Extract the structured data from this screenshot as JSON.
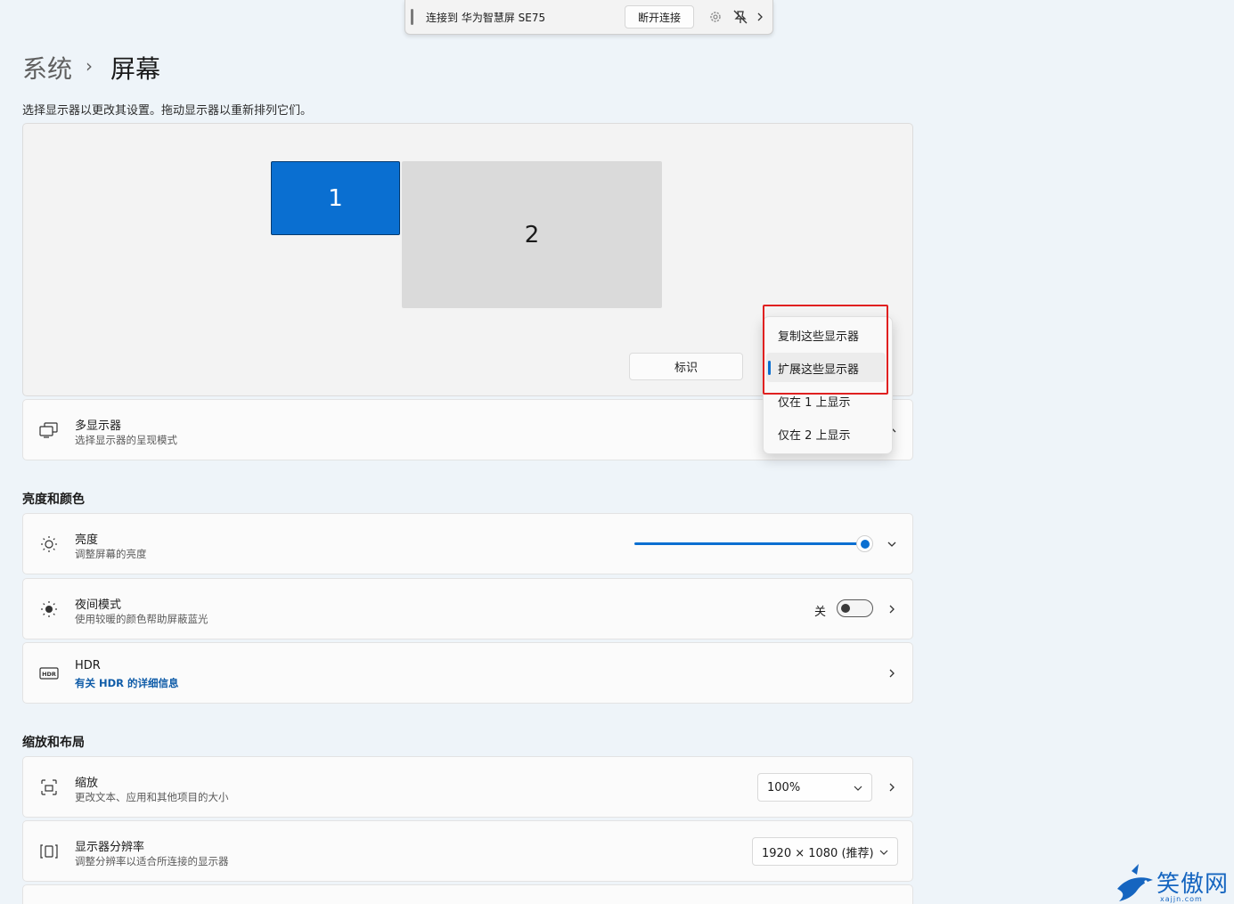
{
  "connection_bar": {
    "text": "连接到 华为智慧屏 SE75",
    "disconnect_label": "断开连接",
    "settings_icon": "gear-icon",
    "pin_icon": "unpin-icon",
    "expand_icon": "chevron-right-icon"
  },
  "breadcrumb": {
    "root": "系统",
    "separator": "›",
    "current": "屏幕"
  },
  "hint": "选择显示器以更改其设置。拖动显示器以重新排列它们。",
  "arrangement": {
    "monitor_1": "1",
    "monitor_2": "2",
    "identify_label": "标识"
  },
  "multi_display": {
    "title": "多显示器",
    "subtitle": "选择显示器的呈现模式",
    "icon": "multi-monitor-icon"
  },
  "dropdown_menu": {
    "items": [
      "复制这些显示器",
      "扩展这些显示器",
      "仅在 1 上显示",
      "仅在 2 上显示"
    ],
    "selected_index": 1
  },
  "brightness_section": {
    "title": "亮度和颜色",
    "brightness": {
      "title": "亮度",
      "subtitle": "调整屏幕的亮度",
      "icon": "sun-icon",
      "value_percent": 100
    },
    "night_mode": {
      "title": "夜间模式",
      "subtitle": "使用较暖的颜色帮助屏蔽蓝光",
      "icon": "night-light-icon",
      "state_label": "关",
      "on": false
    },
    "hdr": {
      "title": "HDR",
      "link": "有关 HDR 的详细信息",
      "icon": "hdr-icon"
    }
  },
  "layout_section": {
    "title": "缩放和布局",
    "scale": {
      "title": "缩放",
      "subtitle": "更改文本、应用和其他项目的大小",
      "icon": "scale-icon",
      "value": "100%"
    },
    "resolution": {
      "title": "显示器分辨率",
      "subtitle": "调整分辨率以适合所连接的显示器",
      "icon": "resolution-icon",
      "value": "1920 × 1080 (推荐)"
    }
  },
  "watermark": {
    "text": "笑傲网",
    "sub": "xajjn.com"
  },
  "colors": {
    "accent": "#0a6fd1",
    "highlight_box": "#e02020",
    "background": "#eef4f9"
  }
}
